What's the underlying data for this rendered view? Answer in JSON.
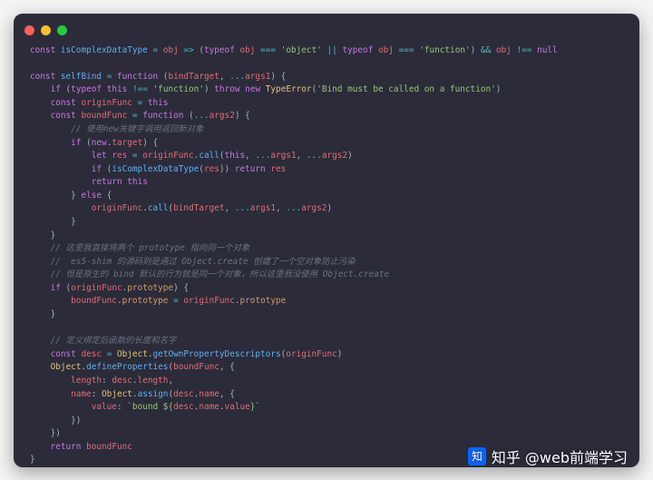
{
  "watermark": "知乎 @web前端学习",
  "code_lines": [
    [
      [
        "kw",
        "const "
      ],
      [
        "fn",
        "isComplexDataType"
      ],
      [
        "pn",
        " "
      ],
      [
        "op",
        "="
      ],
      [
        "pn",
        " "
      ],
      [
        "id",
        "obj"
      ],
      [
        "pn",
        " "
      ],
      [
        "op",
        "=>"
      ],
      [
        "pn",
        " ("
      ],
      [
        "kw",
        "typeof"
      ],
      [
        "pn",
        " "
      ],
      [
        "id",
        "obj"
      ],
      [
        "pn",
        " "
      ],
      [
        "op",
        "==="
      ],
      [
        "pn",
        " "
      ],
      [
        "str",
        "'object'"
      ],
      [
        "pn",
        " "
      ],
      [
        "op",
        "||"
      ],
      [
        "pn",
        " "
      ],
      [
        "kw",
        "typeof"
      ],
      [
        "pn",
        " "
      ],
      [
        "id",
        "obj"
      ],
      [
        "pn",
        " "
      ],
      [
        "op",
        "==="
      ],
      [
        "pn",
        " "
      ],
      [
        "str",
        "'function'"
      ],
      [
        "pn",
        ") "
      ],
      [
        "op",
        "&&"
      ],
      [
        "pn",
        " "
      ],
      [
        "id",
        "obj"
      ],
      [
        "pn",
        " "
      ],
      [
        "op",
        "!=="
      ],
      [
        "pn",
        " "
      ],
      [
        "kw",
        "null"
      ]
    ],
    [],
    [
      [
        "kw",
        "const "
      ],
      [
        "fn",
        "selfBind"
      ],
      [
        "pn",
        " "
      ],
      [
        "op",
        "="
      ],
      [
        "pn",
        " "
      ],
      [
        "kw",
        "function"
      ],
      [
        "pn",
        " ("
      ],
      [
        "id",
        "bindTarget"
      ],
      [
        "pn",
        ", "
      ],
      [
        "op",
        "..."
      ],
      [
        "id",
        "args1"
      ],
      [
        "pn",
        ") {"
      ]
    ],
    [
      [
        "pn",
        "    "
      ],
      [
        "kw",
        "if"
      ],
      [
        "pn",
        " ("
      ],
      [
        "kw",
        "typeof"
      ],
      [
        "pn",
        " "
      ],
      [
        "kw",
        "this"
      ],
      [
        "pn",
        " "
      ],
      [
        "op",
        "!=="
      ],
      [
        "pn",
        " "
      ],
      [
        "str",
        "'function'"
      ],
      [
        "pn",
        ") "
      ],
      [
        "kw",
        "throw"
      ],
      [
        "pn",
        " "
      ],
      [
        "kw",
        "new"
      ],
      [
        "pn",
        " "
      ],
      [
        "ty",
        "TypeError"
      ],
      [
        "pn",
        "("
      ],
      [
        "str",
        "'Bind must be called on a function'"
      ],
      [
        "pn",
        ")"
      ]
    ],
    [
      [
        "pn",
        "    "
      ],
      [
        "kw",
        "const "
      ],
      [
        "id",
        "originFunc"
      ],
      [
        "pn",
        " "
      ],
      [
        "op",
        "="
      ],
      [
        "pn",
        " "
      ],
      [
        "kw",
        "this"
      ]
    ],
    [
      [
        "pn",
        "    "
      ],
      [
        "kw",
        "const "
      ],
      [
        "id",
        "boundFunc"
      ],
      [
        "pn",
        " "
      ],
      [
        "op",
        "="
      ],
      [
        "pn",
        " "
      ],
      [
        "kw",
        "function"
      ],
      [
        "pn",
        " ("
      ],
      [
        "op",
        "..."
      ],
      [
        "id",
        "args2"
      ],
      [
        "pn",
        ") {"
      ]
    ],
    [
      [
        "pn",
        "        "
      ],
      [
        "cm",
        "// 使用new关键字调用返回新对象"
      ]
    ],
    [
      [
        "pn",
        "        "
      ],
      [
        "kw",
        "if"
      ],
      [
        "pn",
        " ("
      ],
      [
        "kw",
        "new"
      ],
      [
        "pn",
        "."
      ],
      [
        "id",
        "target"
      ],
      [
        "pn",
        ") {"
      ]
    ],
    [
      [
        "pn",
        "            "
      ],
      [
        "kw",
        "let "
      ],
      [
        "id",
        "res"
      ],
      [
        "pn",
        " "
      ],
      [
        "op",
        "="
      ],
      [
        "pn",
        " "
      ],
      [
        "id",
        "originFunc"
      ],
      [
        "pn",
        "."
      ],
      [
        "fn",
        "call"
      ],
      [
        "pn",
        "("
      ],
      [
        "kw",
        "this"
      ],
      [
        "pn",
        ", "
      ],
      [
        "op",
        "..."
      ],
      [
        "id",
        "args1"
      ],
      [
        "pn",
        ", "
      ],
      [
        "op",
        "..."
      ],
      [
        "id",
        "args2"
      ],
      [
        "pn",
        ")"
      ]
    ],
    [
      [
        "pn",
        "            "
      ],
      [
        "kw",
        "if"
      ],
      [
        "pn",
        " ("
      ],
      [
        "fn",
        "isComplexDataType"
      ],
      [
        "pn",
        "("
      ],
      [
        "id",
        "res"
      ],
      [
        "pn",
        ")) "
      ],
      [
        "kw",
        "return"
      ],
      [
        "pn",
        " "
      ],
      [
        "id",
        "res"
      ]
    ],
    [
      [
        "pn",
        "            "
      ],
      [
        "kw",
        "return"
      ],
      [
        "pn",
        " "
      ],
      [
        "kw",
        "this"
      ]
    ],
    [
      [
        "pn",
        "        } "
      ],
      [
        "kw",
        "else"
      ],
      [
        "pn",
        " {"
      ]
    ],
    [
      [
        "pn",
        "            "
      ],
      [
        "id",
        "originFunc"
      ],
      [
        "pn",
        "."
      ],
      [
        "fn",
        "call"
      ],
      [
        "pn",
        "("
      ],
      [
        "id",
        "bindTarget"
      ],
      [
        "pn",
        ", "
      ],
      [
        "op",
        "..."
      ],
      [
        "id",
        "args1"
      ],
      [
        "pn",
        ", "
      ],
      [
        "op",
        "..."
      ],
      [
        "id",
        "args2"
      ],
      [
        "pn",
        ")"
      ]
    ],
    [
      [
        "pn",
        "        }"
      ]
    ],
    [
      [
        "pn",
        "    }"
      ]
    ],
    [
      [
        "pn",
        "    "
      ],
      [
        "cm",
        "// 这里我直接将两个 prototype 指向同一个对象"
      ]
    ],
    [
      [
        "pn",
        "    "
      ],
      [
        "cm",
        "//  es5-shim 的源码则是通过 Object.create 创建了一个空对象防止污染"
      ]
    ],
    [
      [
        "pn",
        "    "
      ],
      [
        "cm",
        "// 但是原生的 bind 默认的行为就是同一个对象，所以这里我没使用 Object.create"
      ]
    ],
    [
      [
        "pn",
        "    "
      ],
      [
        "kw",
        "if"
      ],
      [
        "pn",
        " ("
      ],
      [
        "id",
        "originFunc"
      ],
      [
        "pn",
        "."
      ],
      [
        "id2",
        "prototype"
      ],
      [
        "pn",
        ") {"
      ]
    ],
    [
      [
        "pn",
        "        "
      ],
      [
        "id",
        "boundFunc"
      ],
      [
        "pn",
        "."
      ],
      [
        "id2",
        "prototype"
      ],
      [
        "pn",
        " "
      ],
      [
        "op",
        "="
      ],
      [
        "pn",
        " "
      ],
      [
        "id",
        "originFunc"
      ],
      [
        "pn",
        "."
      ],
      [
        "id2",
        "prototype"
      ]
    ],
    [
      [
        "pn",
        "    }"
      ]
    ],
    [],
    [
      [
        "pn",
        "    "
      ],
      [
        "cm",
        "// 定义绑定后函数的长度和名字"
      ]
    ],
    [
      [
        "pn",
        "    "
      ],
      [
        "kw",
        "const "
      ],
      [
        "id",
        "desc"
      ],
      [
        "pn",
        " "
      ],
      [
        "op",
        "="
      ],
      [
        "pn",
        " "
      ],
      [
        "ty",
        "Object"
      ],
      [
        "pn",
        "."
      ],
      [
        "fn",
        "getOwnPropertyDescriptors"
      ],
      [
        "pn",
        "("
      ],
      [
        "id",
        "originFunc"
      ],
      [
        "pn",
        ")"
      ]
    ],
    [
      [
        "pn",
        "    "
      ],
      [
        "ty",
        "Object"
      ],
      [
        "pn",
        "."
      ],
      [
        "fn",
        "defineProperties"
      ],
      [
        "pn",
        "("
      ],
      [
        "id",
        "boundFunc"
      ],
      [
        "pn",
        ", {"
      ]
    ],
    [
      [
        "pn",
        "        "
      ],
      [
        "id",
        "length"
      ],
      [
        "pn",
        ": "
      ],
      [
        "id",
        "desc"
      ],
      [
        "pn",
        "."
      ],
      [
        "id",
        "length"
      ],
      [
        "pn",
        ","
      ]
    ],
    [
      [
        "pn",
        "        "
      ],
      [
        "id",
        "name"
      ],
      [
        "pn",
        ": "
      ],
      [
        "ty",
        "Object"
      ],
      [
        "pn",
        "."
      ],
      [
        "fn",
        "assign"
      ],
      [
        "pn",
        "("
      ],
      [
        "id",
        "desc"
      ],
      [
        "pn",
        "."
      ],
      [
        "id",
        "name"
      ],
      [
        "pn",
        ", {"
      ]
    ],
    [
      [
        "pn",
        "            "
      ],
      [
        "id",
        "value"
      ],
      [
        "pn",
        ": "
      ],
      [
        "str",
        "`bound ${"
      ],
      [
        "id",
        "desc"
      ],
      [
        "pn",
        "."
      ],
      [
        "id",
        "name"
      ],
      [
        "pn",
        "."
      ],
      [
        "id",
        "value"
      ],
      [
        "str",
        "}`"
      ]
    ],
    [
      [
        "pn",
        "        })"
      ]
    ],
    [
      [
        "pn",
        "    })"
      ]
    ],
    [
      [
        "pn",
        "    "
      ],
      [
        "kw",
        "return"
      ],
      [
        "pn",
        " "
      ],
      [
        "id",
        "boundFunc"
      ]
    ],
    [
      [
        "pn",
        "}"
      ]
    ]
  ]
}
